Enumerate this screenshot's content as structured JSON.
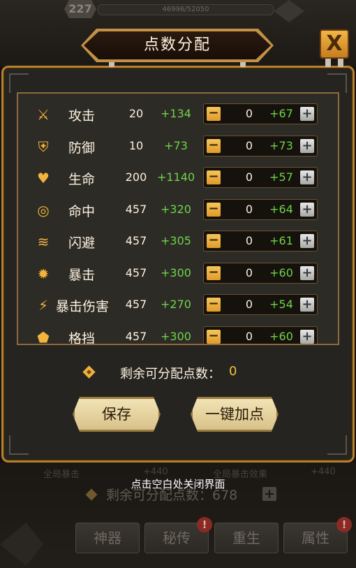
{
  "background": {
    "level": "227",
    "exp_text": "46996/52050",
    "remain_text": "剩余可分配点数：678",
    "faint_left": "全局暴击",
    "faint_left_val": "+440",
    "faint_right": "全局暴击效果",
    "faint_right_val": "+440",
    "tabs": [
      {
        "label": "神器",
        "badge": ""
      },
      {
        "label": "秘传",
        "badge": "!"
      },
      {
        "label": "重生",
        "badge": ""
      },
      {
        "label": "属性",
        "badge": "!"
      }
    ]
  },
  "dialog": {
    "title": "点数分配",
    "close_symbol": "X",
    "rows": [
      {
        "icon": "sword-icon",
        "glyph": "⚔",
        "name": "攻击",
        "base": "20",
        "bonus": "+134",
        "alloc": "0",
        "gain": "+67"
      },
      {
        "icon": "shield-icon",
        "glyph": "⛨",
        "name": "防御",
        "base": "10",
        "bonus": "+73",
        "alloc": "0",
        "gain": "+73"
      },
      {
        "icon": "heart-icon",
        "glyph": "♥",
        "name": "生命",
        "base": "200",
        "bonus": "+1140",
        "alloc": "0",
        "gain": "+57"
      },
      {
        "icon": "target-icon",
        "glyph": "◎",
        "name": "命中",
        "base": "457",
        "bonus": "+320",
        "alloc": "0",
        "gain": "+64"
      },
      {
        "icon": "dodge-icon",
        "glyph": "≋",
        "name": "闪避",
        "base": "457",
        "bonus": "+305",
        "alloc": "0",
        "gain": "+61"
      },
      {
        "icon": "crit-icon",
        "glyph": "✹",
        "name": "暴击",
        "base": "457",
        "bonus": "+300",
        "alloc": "0",
        "gain": "+60"
      },
      {
        "icon": "crit-damage-icon",
        "glyph": "⚡",
        "name": "暴击伤害",
        "base": "457",
        "bonus": "+270",
        "alloc": "0",
        "gain": "+54"
      },
      {
        "icon": "block-icon",
        "glyph": "⬟",
        "name": "格挡",
        "base": "457",
        "bonus": "+300",
        "alloc": "0",
        "gain": "+60"
      }
    ],
    "minus_symbol": "−",
    "plus_symbol": "+",
    "remain_label": "剩余可分配点数：",
    "remain_value": "0",
    "save_label": "保存",
    "auto_label": "一键加点",
    "close_hint": "点击空白处关闭界面"
  },
  "colors": {
    "accent_gold": "#f4b43c",
    "positive_green": "#6fd44a",
    "panel_border": "#b8812f"
  }
}
